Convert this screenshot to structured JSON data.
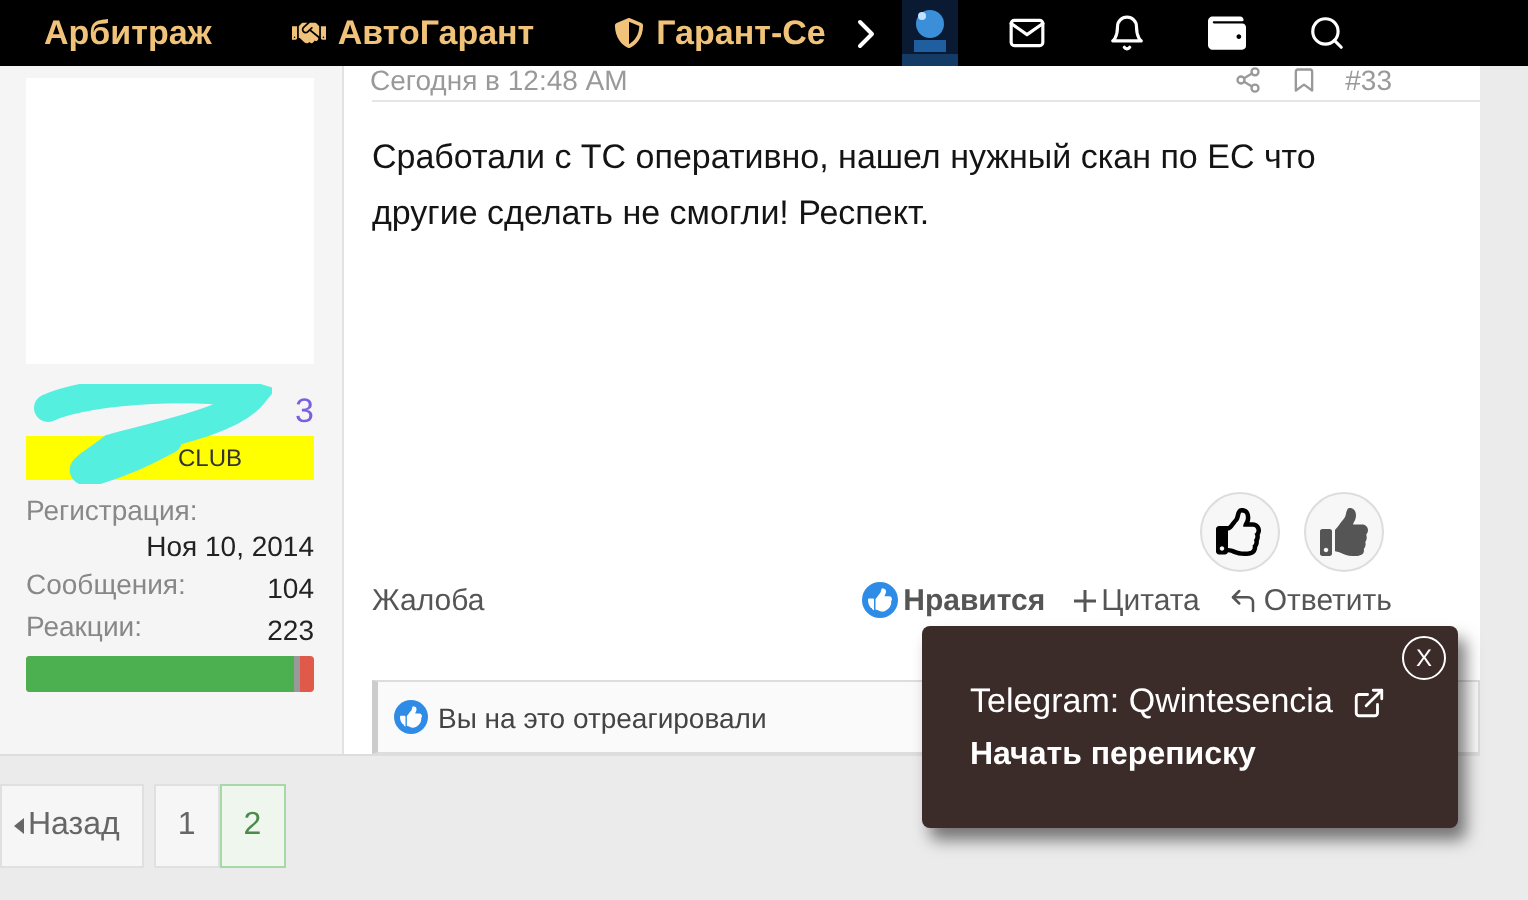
{
  "nav": {
    "items": [
      {
        "label": "Арбитраж",
        "kind": "plain"
      },
      {
        "label": "АвтоГарант",
        "kind": "handshake"
      },
      {
        "label": "Гарант-Се",
        "kind": "shield"
      }
    ]
  },
  "user": {
    "name_tail": "3",
    "banner": "CLUB",
    "stats": [
      {
        "label": "Регистрация:",
        "value": "Ноя 10, 2014",
        "kind": "stacked"
      },
      {
        "label": "Сообщения:",
        "value": "104",
        "kind": "inline"
      },
      {
        "label": "Реакции:",
        "value": "223",
        "kind": "inline"
      }
    ],
    "reaction_bar": {
      "level": 0.95
    }
  },
  "post": {
    "date": "Сегодня в 12:48 AM",
    "number": "#33",
    "text": "Сработали с ТС оперативно, нашел нужный скан по ЕС что другие сделать не смогли! Респект.",
    "report": "Жалоба",
    "actions": [
      {
        "label": "Нравится",
        "kind": "like",
        "selected": true
      },
      {
        "label": "Цитата",
        "kind": "quote",
        "selected": false
      },
      {
        "label": "Ответить",
        "kind": "reply",
        "selected": false
      }
    ],
    "reacted": "Вы на это отреагировали"
  },
  "pagination": {
    "prev": "Назад",
    "pages": [
      {
        "label": "1",
        "selected": false
      },
      {
        "label": "2",
        "selected": true
      }
    ]
  },
  "popup": {
    "close": "X",
    "line": "Telegram: Qwintesencia",
    "action": "Начать переписку"
  }
}
